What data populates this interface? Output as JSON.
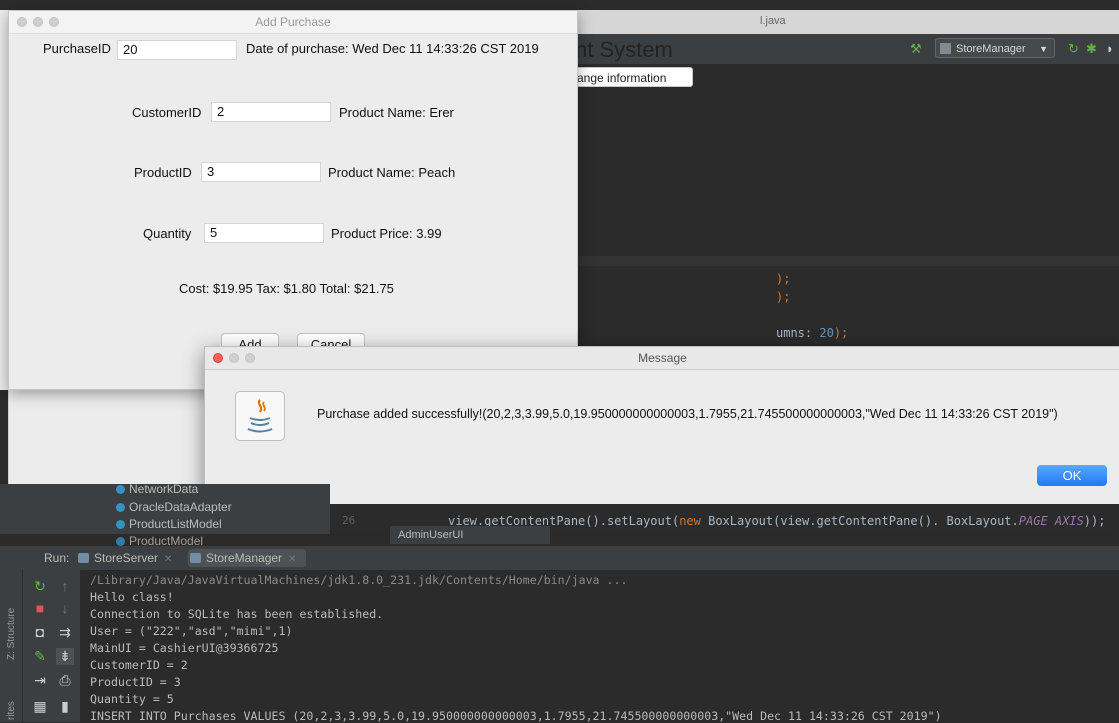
{
  "ide": {
    "file_tab": "l.java",
    "run_config": "StoreManager",
    "code_lines": [
      ");",
      ");",
      "umns: 20);"
    ],
    "code_number": "20"
  },
  "app": {
    "title_fragment": "nt System",
    "button_fragment": "ange information"
  },
  "add_purchase": {
    "title": "Add Purchase",
    "purchase_id_label": "PurchaseID",
    "purchase_id_value": "20",
    "date_text": "Date of purchase: Wed Dec 11 14:33:26 CST 2019",
    "customer_id_label": "CustomerID",
    "customer_id_value": "2",
    "customer_name_text": "Product Name: Erer",
    "product_id_label": "ProductID",
    "product_id_value": "3",
    "product_name_text": "Product Name: Peach",
    "quantity_label": "Quantity",
    "quantity_value": "5",
    "price_text": "Product Price: 3.99",
    "totals_text": "Cost: $19.95 Tax: $1.80 Total: $21.75",
    "add_button": "Add",
    "cancel_button": "Cancel"
  },
  "message": {
    "title": "Message",
    "text": "Purchase added successfully!(20,2,3,3.99,5.0,19.950000000000003,1.7955,21.745500000000003,\"Wed Dec 11 14:33:26 CST 2019\")",
    "ok_button": "OK"
  },
  "project_tree": {
    "items": [
      "NetworkData",
      "OracleDataAdapter",
      "ProductListModel",
      "ProductModel"
    ]
  },
  "editor": {
    "line_number": "26",
    "code_prefix": "view.getContentPane().setLayout(",
    "code_new": "new",
    "code_middle": " BoxLayout(view.getContentPane(). BoxLayout.",
    "code_const": "PAGE AXIS",
    "code_suffix": "));",
    "tooltip": "AdminUserUI"
  },
  "run_panel": {
    "label": "Run:",
    "tabs": [
      "StoreServer",
      "StoreManager"
    ],
    "side_labels": [
      "Z: Structure",
      "rites"
    ],
    "console_lines": [
      "/Library/Java/JavaVirtualMachines/jdk1.8.0_231.jdk/Contents/Home/bin/java ...",
      "Hello class!",
      "Connection to SQLite has been established.",
      "User = (\"222\",\"asd\",\"mimi\",1)",
      "MainUI = CashierUI@39366725",
      "CustomerID = 2",
      "ProductID = 3",
      "Quantity = 5",
      "INSERT INTO Purchases VALUES (20,2,3,3.99,5.0,19.950000000000003,1.7955,21.745500000000003,\"Wed Dec 11 14:33:26 CST 2019\")"
    ]
  },
  "colors": {
    "ok_button": "#1d7cf2",
    "close_red": "#fc605b",
    "ide_dark": "#2b2b2b",
    "ide_panel": "#3c3f41"
  }
}
